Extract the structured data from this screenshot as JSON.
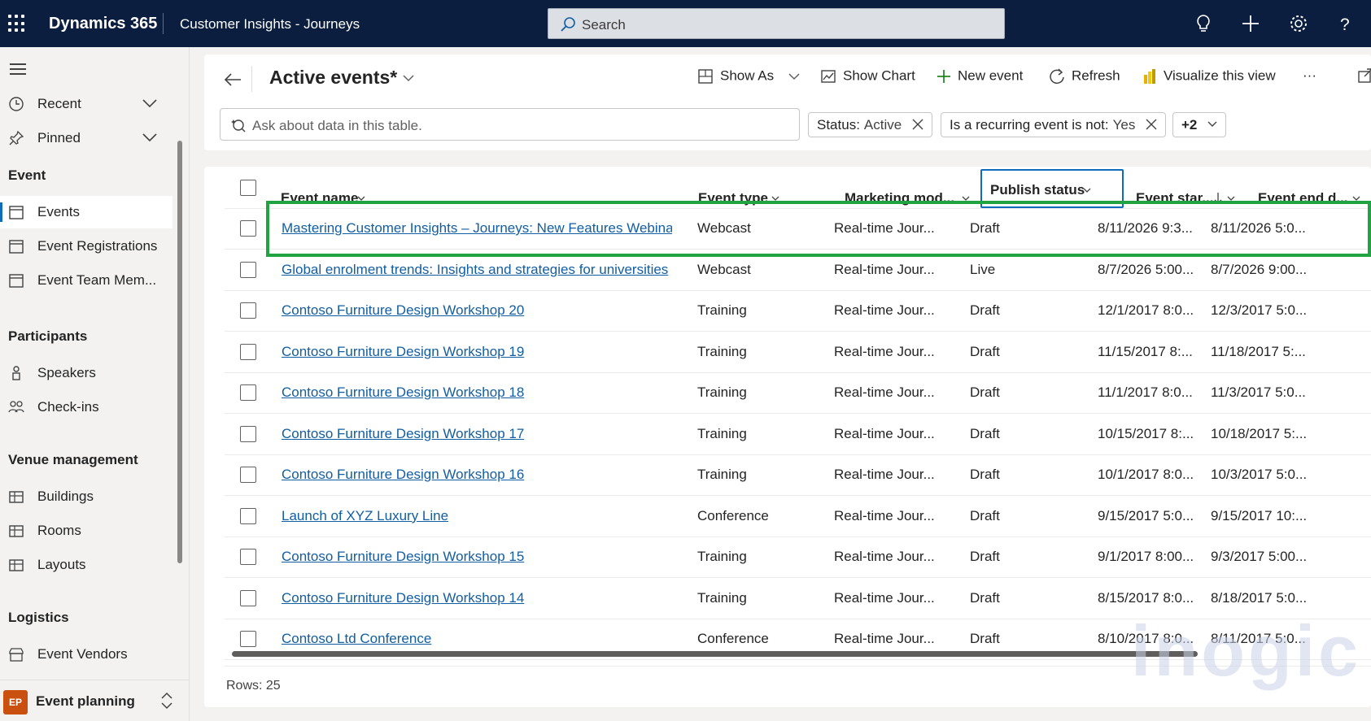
{
  "topbar": {
    "brand": "Dynamics 365",
    "app_name": "Customer Insights - Journeys",
    "search_placeholder": "Search"
  },
  "nav": {
    "recent": "Recent",
    "pinned": "Pinned",
    "group_event": "Event",
    "events": "Events",
    "event_registrations": "Event Registrations",
    "event_team": "Event Team Mem...",
    "group_participants": "Participants",
    "speakers": "Speakers",
    "checkins": "Check-ins",
    "group_venue": "Venue management",
    "buildings": "Buildings",
    "rooms": "Rooms",
    "layouts": "Layouts",
    "group_logistics": "Logistics",
    "event_vendors": "Event Vendors",
    "area_badge": "EP",
    "area_label": "Event planning"
  },
  "header": {
    "title": "Active events*",
    "show_as": "Show As",
    "show_chart": "Show Chart",
    "new_event": "New event",
    "refresh": "Refresh",
    "visualize": "Visualize this view",
    "more": "···",
    "ask_placeholder": "Ask about data in this table.",
    "filter1_key": "Status:",
    "filter1_val": "Active",
    "filter2_key": "Is a recurring event is not:",
    "filter2_val": "Yes",
    "more_filters": "+2"
  },
  "grid": {
    "columns": [
      "Event name",
      "Event type",
      "Marketing mod...",
      "Publish status",
      "Event star...",
      "Event end d..."
    ],
    "rows": [
      [
        "Mastering Customer Insights – Journeys: New Features Webinar",
        "Webcast",
        "Real-time Jour...",
        "Draft",
        "8/11/2026 9:3...",
        "8/11/2026 5:0..."
      ],
      [
        "Global enrolment trends: Insights and strategies for universities",
        "Webcast",
        "Real-time Jour...",
        "Live",
        "8/7/2026 5:00...",
        "8/7/2026 9:00..."
      ],
      [
        "Contoso Furniture Design Workshop 20",
        "Training",
        "Real-time Jour...",
        "Draft",
        "12/1/2017 8:0...",
        "12/3/2017 5:0..."
      ],
      [
        "Contoso Furniture Design Workshop 19",
        "Training",
        "Real-time Jour...",
        "Draft",
        "11/15/2017 8:...",
        "11/18/2017 5:..."
      ],
      [
        "Contoso Furniture Design Workshop 18",
        "Training",
        "Real-time Jour...",
        "Draft",
        "11/1/2017 8:0...",
        "11/3/2017 5:0..."
      ],
      [
        "Contoso Furniture Design Workshop 17",
        "Training",
        "Real-time Jour...",
        "Draft",
        "10/15/2017 8:...",
        "10/18/2017 5:..."
      ],
      [
        "Contoso Furniture Design Workshop 16",
        "Training",
        "Real-time Jour...",
        "Draft",
        "10/1/2017 8:0...",
        "10/3/2017 5:0..."
      ],
      [
        "Launch of XYZ Luxury Line",
        "Conference",
        "Real-time Jour...",
        "Draft",
        "9/15/2017 5:0...",
        "9/15/2017 10:..."
      ],
      [
        "Contoso Furniture Design Workshop 15",
        "Training",
        "Real-time Jour...",
        "Draft",
        "9/1/2017 8:00...",
        "9/3/2017 5:00..."
      ],
      [
        "Contoso Furniture Design Workshop 14",
        "Training",
        "Real-time Jour...",
        "Draft",
        "8/15/2017 8:0...",
        "8/18/2017 5:0..."
      ],
      [
        "Contoso Ltd Conference",
        "Conference",
        "Real-time Jour...",
        "Draft",
        "8/10/2017 8:0...",
        "8/11/2017 5:0..."
      ]
    ],
    "rows_count": "Rows: 25"
  },
  "watermark": "inogic",
  "colors": {
    "topbar": "#0b1e3f",
    "link": "#115ea3",
    "highlight": "#21a341",
    "focus": "#0f6cbd",
    "area_badge": "#ca5010"
  }
}
